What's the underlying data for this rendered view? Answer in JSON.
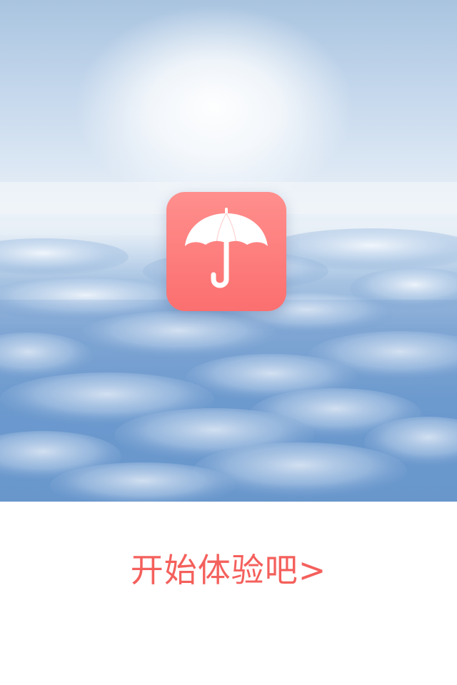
{
  "splash": {
    "background": "sky-above-clouds-photo",
    "app_icon": {
      "icon": "umbrella-icon",
      "background_color": "#fb6f6f",
      "glyph_color": "#ffffff"
    },
    "cta": {
      "label": "开始体验吧>",
      "color": "#f4605c"
    }
  }
}
